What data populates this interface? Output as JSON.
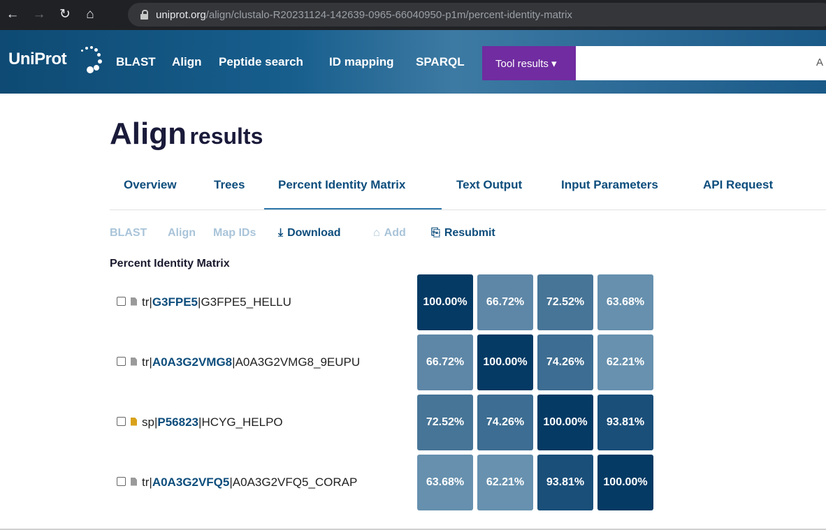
{
  "browser": {
    "url_host": "uniprot.org",
    "url_path": "/align/clustalo-R20231124-142639-0965-66040950-p1m/percent-identity-matrix"
  },
  "header": {
    "logo_text": "UniProt",
    "nav": [
      "BLAST",
      "Align",
      "Peptide search",
      "ID mapping",
      "SPARQL"
    ],
    "tool_results_label": "Tool results ▾",
    "search_partial": "A"
  },
  "page": {
    "title_main": "Align",
    "title_suffix": "results"
  },
  "tabs": [
    {
      "label": "Overview",
      "active": false
    },
    {
      "label": "Trees",
      "active": false
    },
    {
      "label": "Percent Identity Matrix",
      "active": true
    },
    {
      "label": "Text Output",
      "active": false
    },
    {
      "label": "Input Parameters",
      "active": false
    },
    {
      "label": "API Request",
      "active": false
    }
  ],
  "actions": [
    {
      "label": "BLAST",
      "enabled": false,
      "icon": ""
    },
    {
      "label": "Align",
      "enabled": false,
      "icon": ""
    },
    {
      "label": "Map IDs",
      "enabled": false,
      "icon": ""
    },
    {
      "label": "Download",
      "enabled": true,
      "icon": "download-icon"
    },
    {
      "label": "Add",
      "enabled": false,
      "icon": "basket-icon"
    },
    {
      "label": "Resubmit",
      "enabled": true,
      "icon": "resubmit-icon"
    }
  ],
  "matrix": {
    "title": "Percent Identity Matrix",
    "rows": [
      {
        "db": "tr",
        "accession": "G3FPE5",
        "entry_name": "G3FPE5_HELLU",
        "reviewed": false,
        "values": [
          "100.00%",
          "66.72%",
          "72.52%",
          "63.68%"
        ]
      },
      {
        "db": "tr",
        "accession": "A0A3G2VMG8",
        "entry_name": "A0A3G2VMG8_9EUPU",
        "reviewed": false,
        "values": [
          "66.72%",
          "100.00%",
          "74.26%",
          "62.21%"
        ]
      },
      {
        "db": "sp",
        "accession": "P56823",
        "entry_name": "HCYG_HELPO",
        "reviewed": true,
        "values": [
          "72.52%",
          "74.26%",
          "100.00%",
          "93.81%"
        ]
      },
      {
        "db": "tr",
        "accession": "A0A3G2VFQ5",
        "entry_name": "A0A3G2VFQ5_CORAP",
        "reviewed": false,
        "values": [
          "63.68%",
          "62.21%",
          "93.81%",
          "100.00%"
        ]
      }
    ],
    "colors": {
      "c100": "#043a64",
      "c93": "#1a4f7a",
      "c74": "#3d6d92",
      "c72": "#477597",
      "c66": "#5e87a7",
      "c63": "#6690ae",
      "c62": "#6791af"
    }
  }
}
